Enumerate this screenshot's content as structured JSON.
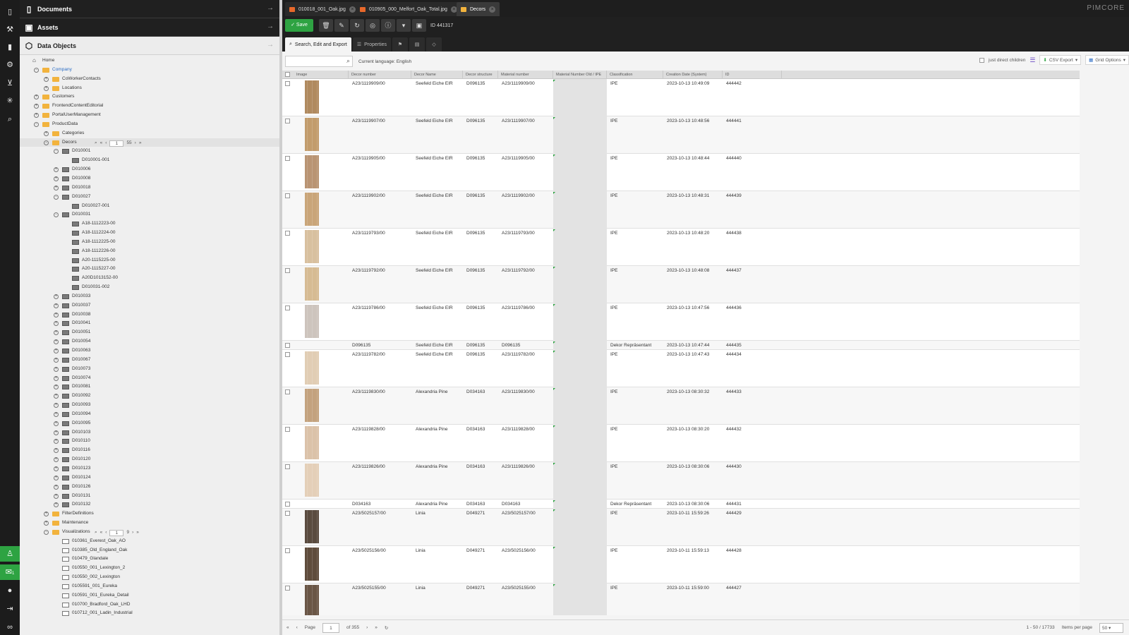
{
  "rail": {
    "icons": [
      "file-icon",
      "wrench-icon",
      "chart-icon",
      "gear-icon",
      "cart-icon",
      "network-icon",
      "search-icon"
    ],
    "bottom_icons": [
      "user-icon",
      "chat-icon",
      "person-icon",
      "logout-icon",
      "infinity-icon"
    ],
    "notification_count": "1"
  },
  "panels": {
    "documents": "Documents",
    "assets": "Assets",
    "data_objects": "Data Objects"
  },
  "tree": [
    {
      "label": "Home",
      "level": 0,
      "type": "home"
    },
    {
      "label": "Company",
      "level": 1,
      "type": "folder",
      "toggle": "-",
      "link": true
    },
    {
      "label": "CoWorkerContacts",
      "level": 2,
      "type": "folder",
      "toggle": "+"
    },
    {
      "label": "Locations",
      "level": 2,
      "type": "folder",
      "toggle": "+"
    },
    {
      "label": "Customers",
      "level": 1,
      "type": "folder",
      "toggle": "+"
    },
    {
      "label": "FrontendContentEditorial",
      "level": 1,
      "type": "folder",
      "toggle": "+"
    },
    {
      "label": "PortalUserManagement",
      "level": 1,
      "type": "folder",
      "toggle": "+"
    },
    {
      "label": "ProductData",
      "level": 1,
      "type": "folder",
      "toggle": "-"
    },
    {
      "label": "Categories",
      "level": 2,
      "type": "folder",
      "toggle": "+"
    },
    {
      "label": "Decors",
      "level": 2,
      "type": "folder",
      "toggle": "-",
      "pager": {
        "page": "1",
        "total": "55"
      },
      "selected": true
    },
    {
      "label": "D010001",
      "level": 3,
      "type": "obj",
      "toggle": "-"
    },
    {
      "label": "D010001-001",
      "level": 4,
      "type": "obj"
    },
    {
      "label": "D010006",
      "level": 3,
      "type": "obj",
      "toggle": "+"
    },
    {
      "label": "D010008",
      "level": 3,
      "type": "obj",
      "toggle": "+"
    },
    {
      "label": "D010018",
      "level": 3,
      "type": "obj",
      "toggle": "+"
    },
    {
      "label": "D010027",
      "level": 3,
      "type": "obj",
      "toggle": "-"
    },
    {
      "label": "D010027-001",
      "level": 4,
      "type": "obj"
    },
    {
      "label": "D010031",
      "level": 3,
      "type": "obj",
      "toggle": "-"
    },
    {
      "label": "A18-1112223-00",
      "level": 4,
      "type": "obj"
    },
    {
      "label": "A18-1112224-00",
      "level": 4,
      "type": "obj"
    },
    {
      "label": "A18-1112225-00",
      "level": 4,
      "type": "obj"
    },
    {
      "label": "A18-1112226-00",
      "level": 4,
      "type": "obj"
    },
    {
      "label": "A20-1115225-00",
      "level": 4,
      "type": "obj"
    },
    {
      "label": "A20-1115227-00",
      "level": 4,
      "type": "obj"
    },
    {
      "label": "A20D1013152-00",
      "level": 4,
      "type": "obj"
    },
    {
      "label": "D010031-002",
      "level": 4,
      "type": "obj"
    },
    {
      "label": "D010033",
      "level": 3,
      "type": "obj",
      "toggle": "+"
    },
    {
      "label": "D010037",
      "level": 3,
      "type": "obj",
      "toggle": "+"
    },
    {
      "label": "D010038",
      "level": 3,
      "type": "obj",
      "toggle": "+"
    },
    {
      "label": "D010041",
      "level": 3,
      "type": "obj",
      "toggle": "+"
    },
    {
      "label": "D010051",
      "level": 3,
      "type": "obj",
      "toggle": "+"
    },
    {
      "label": "D010054",
      "level": 3,
      "type": "obj",
      "toggle": "+"
    },
    {
      "label": "D010063",
      "level": 3,
      "type": "obj",
      "toggle": "+"
    },
    {
      "label": "D010067",
      "level": 3,
      "type": "obj",
      "toggle": "+"
    },
    {
      "label": "D010073",
      "level": 3,
      "type": "obj",
      "toggle": "+"
    },
    {
      "label": "D010074",
      "level": 3,
      "type": "obj",
      "toggle": "+"
    },
    {
      "label": "D010081",
      "level": 3,
      "type": "obj",
      "toggle": "+"
    },
    {
      "label": "D010092",
      "level": 3,
      "type": "obj",
      "toggle": "+"
    },
    {
      "label": "D010093",
      "level": 3,
      "type": "obj",
      "toggle": "+"
    },
    {
      "label": "D010094",
      "level": 3,
      "type": "obj",
      "toggle": "+"
    },
    {
      "label": "D010095",
      "level": 3,
      "type": "obj",
      "toggle": "+"
    },
    {
      "label": "D010103",
      "level": 3,
      "type": "obj",
      "toggle": "+"
    },
    {
      "label": "D010110",
      "level": 3,
      "type": "obj",
      "toggle": "+"
    },
    {
      "label": "D010116",
      "level": 3,
      "type": "obj",
      "toggle": "+"
    },
    {
      "label": "D010120",
      "level": 3,
      "type": "obj",
      "toggle": "+"
    },
    {
      "label": "D010123",
      "level": 3,
      "type": "obj",
      "toggle": "+"
    },
    {
      "label": "D010124",
      "level": 3,
      "type": "obj",
      "toggle": "+"
    },
    {
      "label": "D010126",
      "level": 3,
      "type": "obj",
      "toggle": "+"
    },
    {
      "label": "D010131",
      "level": 3,
      "type": "obj",
      "toggle": "+"
    },
    {
      "label": "D010132",
      "level": 3,
      "type": "obj",
      "toggle": "+"
    },
    {
      "label": "FilterDefinitions",
      "level": 2,
      "type": "folder",
      "toggle": "+"
    },
    {
      "label": "Maintenance",
      "level": 2,
      "type": "folder",
      "toggle": "+"
    },
    {
      "label": "Visualizations",
      "level": 2,
      "type": "folder",
      "toggle": "-",
      "pager": {
        "page": "1",
        "total": "9"
      }
    },
    {
      "label": "010361_Everest_Oak_AO",
      "level": 3,
      "type": "img"
    },
    {
      "label": "010385_Old_England_Oak",
      "level": 3,
      "type": "img"
    },
    {
      "label": "010479_Glandale",
      "level": 3,
      "type": "img"
    },
    {
      "label": "010550_001_Lexington_2",
      "level": 3,
      "type": "img"
    },
    {
      "label": "010550_002_Lexington",
      "level": 3,
      "type": "img"
    },
    {
      "label": "0105591_001_Eureka",
      "level": 3,
      "type": "img"
    },
    {
      "label": "010591_001_Eureka_Detail",
      "level": 3,
      "type": "img"
    },
    {
      "label": "010700_Bradford_Oak_LHD",
      "level": 3,
      "type": "img"
    },
    {
      "label": "010712_001_Ladin_Industrial",
      "level": 3,
      "type": "img"
    }
  ],
  "tabs": [
    {
      "label": "010018_001_Oak.jpg",
      "icon": "image-icon"
    },
    {
      "label": "010905_000_Melfort_Oak_Total.jpg",
      "icon": "image-icon"
    },
    {
      "label": "Decors",
      "icon": "folder-icon",
      "active": true
    }
  ],
  "brand": "PIMCORE",
  "toolbar": {
    "save": "Save",
    "id": "ID 441317",
    "icons": [
      "trash-icon",
      "pencil-icon",
      "reload-icon",
      "target-icon",
      "info-icon",
      "caret-down-icon",
      "layout-icon"
    ]
  },
  "subtabs": {
    "search": "Search, Edit and Export",
    "properties": "Properties"
  },
  "gridbar": {
    "search_placeholder": "",
    "language": "Current language: English",
    "just_direct_children": "just direct children",
    "csv_export": "CSV Export",
    "grid_options": "Grid Options"
  },
  "columns": [
    "Image",
    "Decor number",
    "Decor Name",
    "Decor structure",
    "Material number",
    "Material Number Old / IPE",
    "Classification",
    "Creation Date (System)",
    "ID"
  ],
  "rows": [
    {
      "decor_number": "A23/1119909/00",
      "decor_name": "Seefeld Eiche EIR",
      "structure": "D096135",
      "material": "A23/1119909/00",
      "classification": "IPE",
      "date": "2023-10-13 10:49:09",
      "id": "444442",
      "color": "#b08a5f"
    },
    {
      "decor_number": "A23/1119907/00",
      "decor_name": "Seefeld Eiche EIR",
      "structure": "D096135",
      "material": "A23/1119907/00",
      "classification": "IPE",
      "date": "2023-10-13 10:48:56",
      "id": "444441",
      "color": "#c29c6c"
    },
    {
      "decor_number": "A23/1119905/00",
      "decor_name": "Seefeld Eiche EIR",
      "structure": "D096135",
      "material": "A23/1119905/00",
      "classification": "IPE",
      "date": "2023-10-13 10:48:44",
      "id": "444440",
      "color": "#b99473"
    },
    {
      "decor_number": "A23/1119902/00",
      "decor_name": "Seefeld Eiche EIR",
      "structure": "D096135",
      "material": "A23/1119902/00",
      "classification": "IPE",
      "date": "2023-10-13 10:48:31",
      "id": "444439",
      "color": "#c9a579"
    },
    {
      "decor_number": "A23/1119793/00",
      "decor_name": "Seefeld Eiche EIR",
      "structure": "D096135",
      "material": "A23/1119793/00",
      "classification": "IPE",
      "date": "2023-10-13 10:48:20",
      "id": "444438",
      "color": "#d8c09f"
    },
    {
      "decor_number": "A23/1119792/00",
      "decor_name": "Seefeld Eiche EIR",
      "structure": "D096135",
      "material": "A23/1119792/00",
      "classification": "IPE",
      "date": "2023-10-13 10:48:08",
      "id": "444437",
      "color": "#d6bb93"
    },
    {
      "decor_number": "A23/1119786/00",
      "decor_name": "Seefeld Eiche EIR",
      "structure": "D096135",
      "material": "A23/1119786/00",
      "classification": "IPE",
      "date": "2023-10-13 10:47:56",
      "id": "444436",
      "color": "#cdc4bd"
    },
    {
      "decor_number": "D096135",
      "decor_name": "Seefeld Eiche EIR",
      "structure": "D096135",
      "material": "D096135",
      "classification": "Dekor Repräsentant",
      "date": "2023-10-13 10:47:44",
      "id": "444435",
      "color": ""
    },
    {
      "decor_number": "A23/1119782/00",
      "decor_name": "Seefeld Eiche EIR",
      "structure": "D096135",
      "material": "A23/1119782/00",
      "classification": "IPE",
      "date": "2023-10-13 10:47:43",
      "id": "444434",
      "color": "#e1cdb4"
    },
    {
      "decor_number": "A23/1119830/00",
      "decor_name": "Alexandria Pine",
      "structure": "D034163",
      "material": "A23/1119830/00",
      "classification": "IPE",
      "date": "2023-10-13 08:30:32",
      "id": "444433",
      "color": "#c3a27e"
    },
    {
      "decor_number": "A23/1119828/00",
      "decor_name": "Alexandria Pine",
      "structure": "D034163",
      "material": "A23/1119828/00",
      "classification": "IPE",
      "date": "2023-10-13 08:30:20",
      "id": "444432",
      "color": "#dbc2a9"
    },
    {
      "decor_number": "A23/1119826/00",
      "decor_name": "Alexandria Pine",
      "structure": "D034163",
      "material": "A23/1119826/00",
      "classification": "IPE",
      "date": "2023-10-13 08:30:06",
      "id": "444430",
      "color": "#e4cfb8"
    },
    {
      "decor_number": "D034163",
      "decor_name": "Alexandria Pine",
      "structure": "D034163",
      "material": "D034163",
      "classification": "Dekor Repräsentant",
      "date": "2023-10-13 08:30:06",
      "id": "444431",
      "color": ""
    },
    {
      "decor_number": "A23/5025157/00",
      "decor_name": "Linia",
      "structure": "D049271",
      "material": "A23/5025157/00",
      "classification": "IPE",
      "date": "2023-10-11 15:59:26",
      "id": "444429",
      "color": "#5a4b3f"
    },
    {
      "decor_number": "A23/5025156/00",
      "decor_name": "Linia",
      "structure": "D049271",
      "material": "A23/5025156/00",
      "classification": "IPE",
      "date": "2023-10-11 15:59:13",
      "id": "444428",
      "color": "#5f4c3c"
    },
    {
      "decor_number": "A23/5025155/00",
      "decor_name": "Linia",
      "structure": "D049271",
      "material": "A23/5025155/00",
      "classification": "IPE",
      "date": "2023-10-11 15:59:00",
      "id": "444427",
      "color": "#6a5646"
    }
  ],
  "footer": {
    "page_label": "Page",
    "page": "1",
    "of": "of 355",
    "summary": "1 - 50 / 17733",
    "items_per_page_label": "Items per page",
    "items_per_page": "50"
  },
  "colors": {
    "accent_green": "#2ea342",
    "folder": "#f2b33d",
    "link": "#2a6cc4"
  }
}
